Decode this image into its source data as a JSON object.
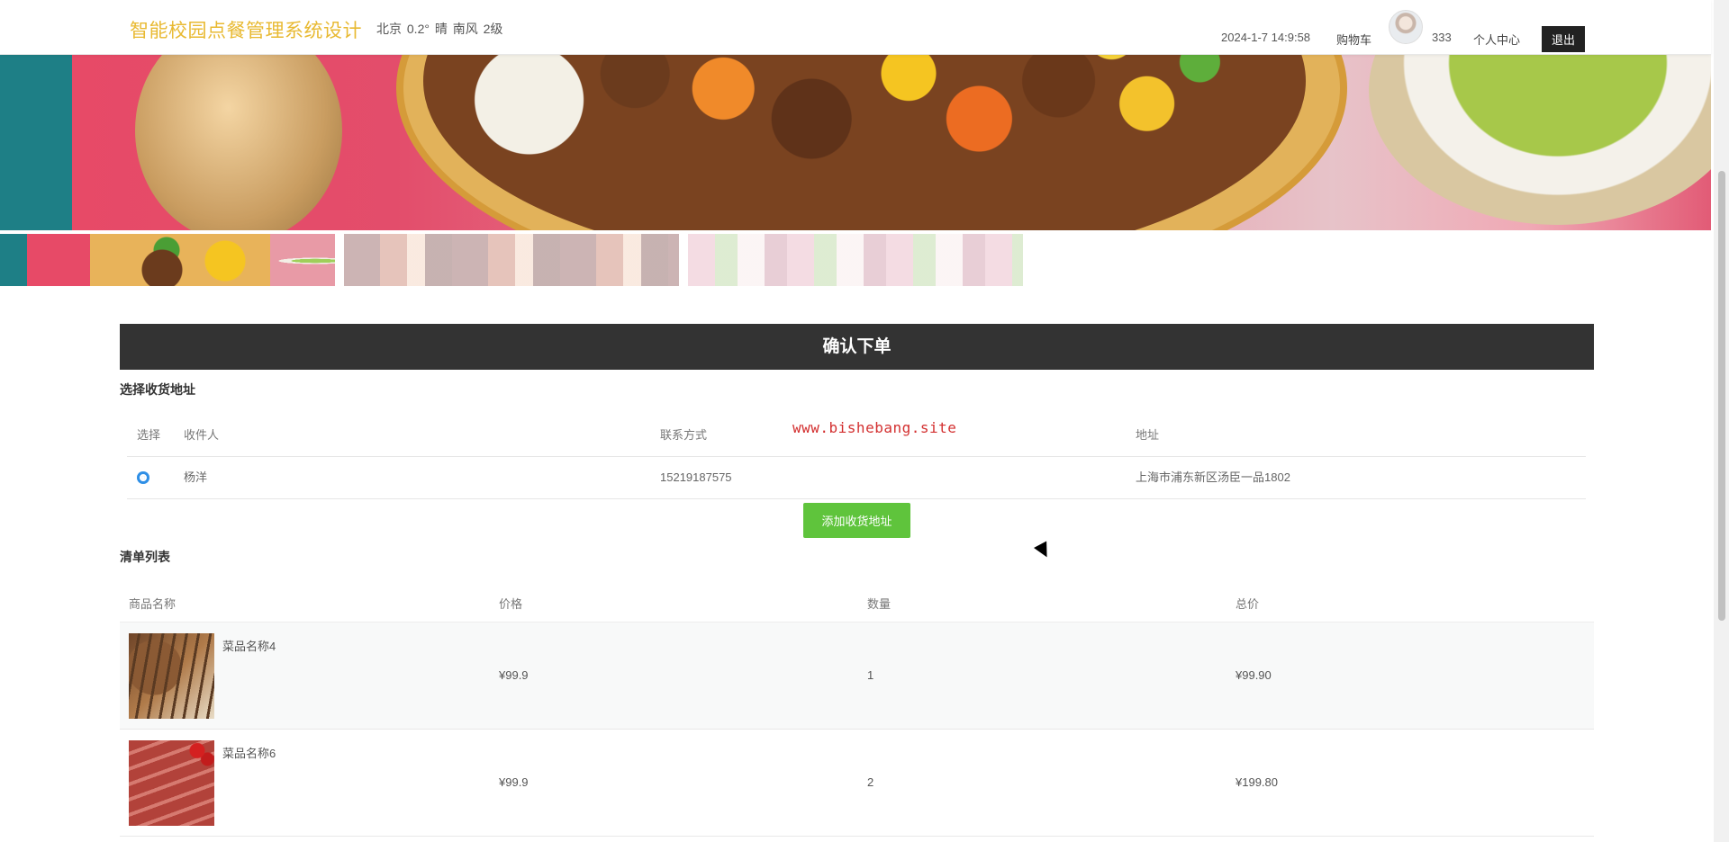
{
  "header": {
    "site_title": "智能校园点餐管理系统设计",
    "weather": "北京  0.2°  晴  南风  2级",
    "datetime": "2024-1-7 14:9:58",
    "cart_label": "购物车",
    "username": "333",
    "profile_label": "个人中心",
    "logout_label": "退出"
  },
  "banner": {
    "thumbnail_count": 3,
    "active_thumbnail": 1
  },
  "order": {
    "title": "确认下单",
    "address_section_label": "选择收货地址",
    "address_columns": {
      "select": "选择",
      "recipient": "收件人",
      "contact": "联系方式",
      "address": "地址"
    },
    "addresses": [
      {
        "recipient": "杨洋",
        "phone": "15219187575",
        "address": "上海市浦东新区汤臣一品1802",
        "selected": true
      }
    ],
    "add_address_button": "添加收货地址",
    "watermark": "www.bishebang.site",
    "list_section_label": "清单列表",
    "list_columns": {
      "name": "商品名称",
      "price": "价格",
      "quantity": "数量",
      "total": "总价"
    },
    "items": [
      {
        "name": "菜品名称4",
        "price": "¥99.9",
        "quantity": "1",
        "total": "¥99.90",
        "image": "kebab-image"
      },
      {
        "name": "菜品名称6",
        "price": "¥99.9",
        "quantity": "2",
        "total": "¥199.80",
        "image": "steak-image"
      }
    ]
  },
  "colors": {
    "title_gold": "#e8b931",
    "header_bar": "#333333",
    "accent_green": "#5fc43c",
    "radio_blue": "#2f8fe6",
    "watermark_red": "#d32f2f"
  }
}
